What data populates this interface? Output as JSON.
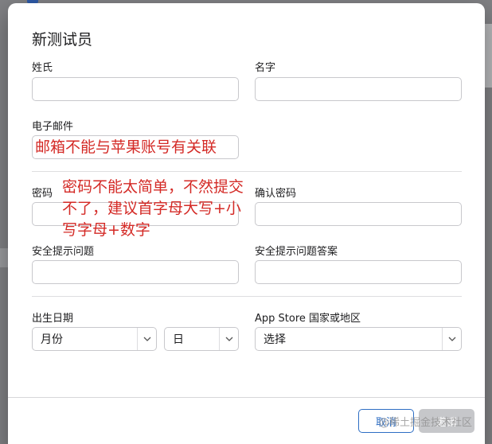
{
  "dialog": {
    "title": "新测试员",
    "labels": {
      "last_name": "姓氏",
      "first_name": "名字",
      "email": "电子邮件",
      "password": "密码",
      "confirm_password": "确认密码",
      "security_question": "安全提示问题",
      "security_answer": "安全提示问题答案",
      "birth_date": "出生日期",
      "app_store_country": "App Store 国家或地区"
    },
    "fields": {
      "last_name": "",
      "first_name": "",
      "email": "",
      "password": "",
      "confirm_password": "",
      "security_question": "",
      "security_answer": ""
    },
    "selects": {
      "month": "月份",
      "day": "日",
      "country": "选择"
    },
    "buttons": {
      "cancel": "取消",
      "invite": "邀请"
    }
  },
  "annotations": {
    "email_note": "邮箱不能与苹果账号有关联",
    "password_note_line1": "密码不能太简单，不然提交",
    "password_note_line2": "不了，建议首字母大写+小",
    "password_note_line3": "写字母+数字"
  },
  "watermark": "@稀土掘金技术社区",
  "colors": {
    "accent": "#2e6ec4",
    "annotation": "#d42a26",
    "disabled_button": "#c6c7ca"
  }
}
